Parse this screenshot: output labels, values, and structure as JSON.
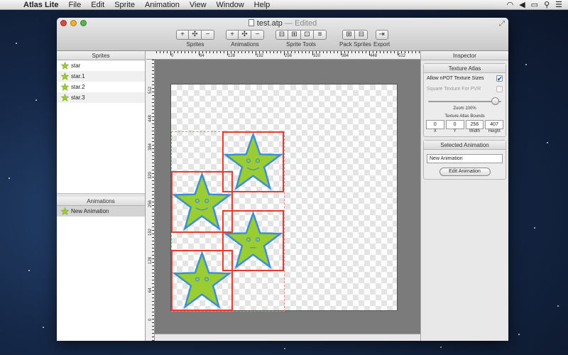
{
  "menubar": {
    "app_name": "Atlas Lite",
    "items": [
      "File",
      "Edit",
      "Sprite",
      "Animation",
      "View",
      "Window",
      "Help"
    ]
  },
  "window": {
    "title": "test.atp",
    "status": "— Edited"
  },
  "toolbar": {
    "groups": [
      {
        "label": "Sprites",
        "buttons": [
          "+",
          "✣",
          "−"
        ]
      },
      {
        "label": "Animations",
        "buttons": [
          "+",
          "✣",
          "−"
        ]
      },
      {
        "label": "Sprite Tools",
        "buttons": [
          "⊟",
          "⊞",
          "⊡",
          "≡"
        ]
      },
      {
        "label": "Pack Sprites",
        "buttons": [
          "⊞",
          "⊟"
        ]
      },
      {
        "label": "Export",
        "buttons": [
          "⇥"
        ]
      }
    ]
  },
  "sidebar": {
    "sprites_header": "Sprites",
    "sprites": [
      "star",
      "star.1",
      "star.2",
      "star.3"
    ],
    "animations_header": "Animations",
    "animations": [
      "New Animation"
    ]
  },
  "rulers": {
    "horizontal": [
      "0",
      "64",
      "128",
      "192",
      "256",
      "320",
      "384",
      "448",
      "512"
    ],
    "vertical": [
      "512",
      "448",
      "384",
      "320",
      "256",
      "192",
      "128",
      "64",
      "0"
    ]
  },
  "inspector": {
    "header": "Inspector",
    "texture_atlas": {
      "header": "Texture Atlas",
      "allow_npot_label": "Allow nPOT Texture Sizes",
      "allow_npot_checked": "✔",
      "square_pvr_label": "Square Texture For PVR",
      "zoom_label": "Zoom 100%",
      "zoom_value": 1.0,
      "bounds_label": "Texture Atlas Bounds",
      "bounds": {
        "x": "0",
        "y": "0",
        "width": "256",
        "height": "407"
      },
      "bounds_labels": {
        "x": "X",
        "y": "Y",
        "width": "Width",
        "height": "Height"
      }
    },
    "selected_animation": {
      "header": "Selected Animation",
      "name_value": "New Animation",
      "edit_button": "Edit Animation"
    }
  },
  "colors": {
    "selection_border": "#e63b2e",
    "star_fill": "#9acd32",
    "star_stroke": "#3a8fd6"
  }
}
